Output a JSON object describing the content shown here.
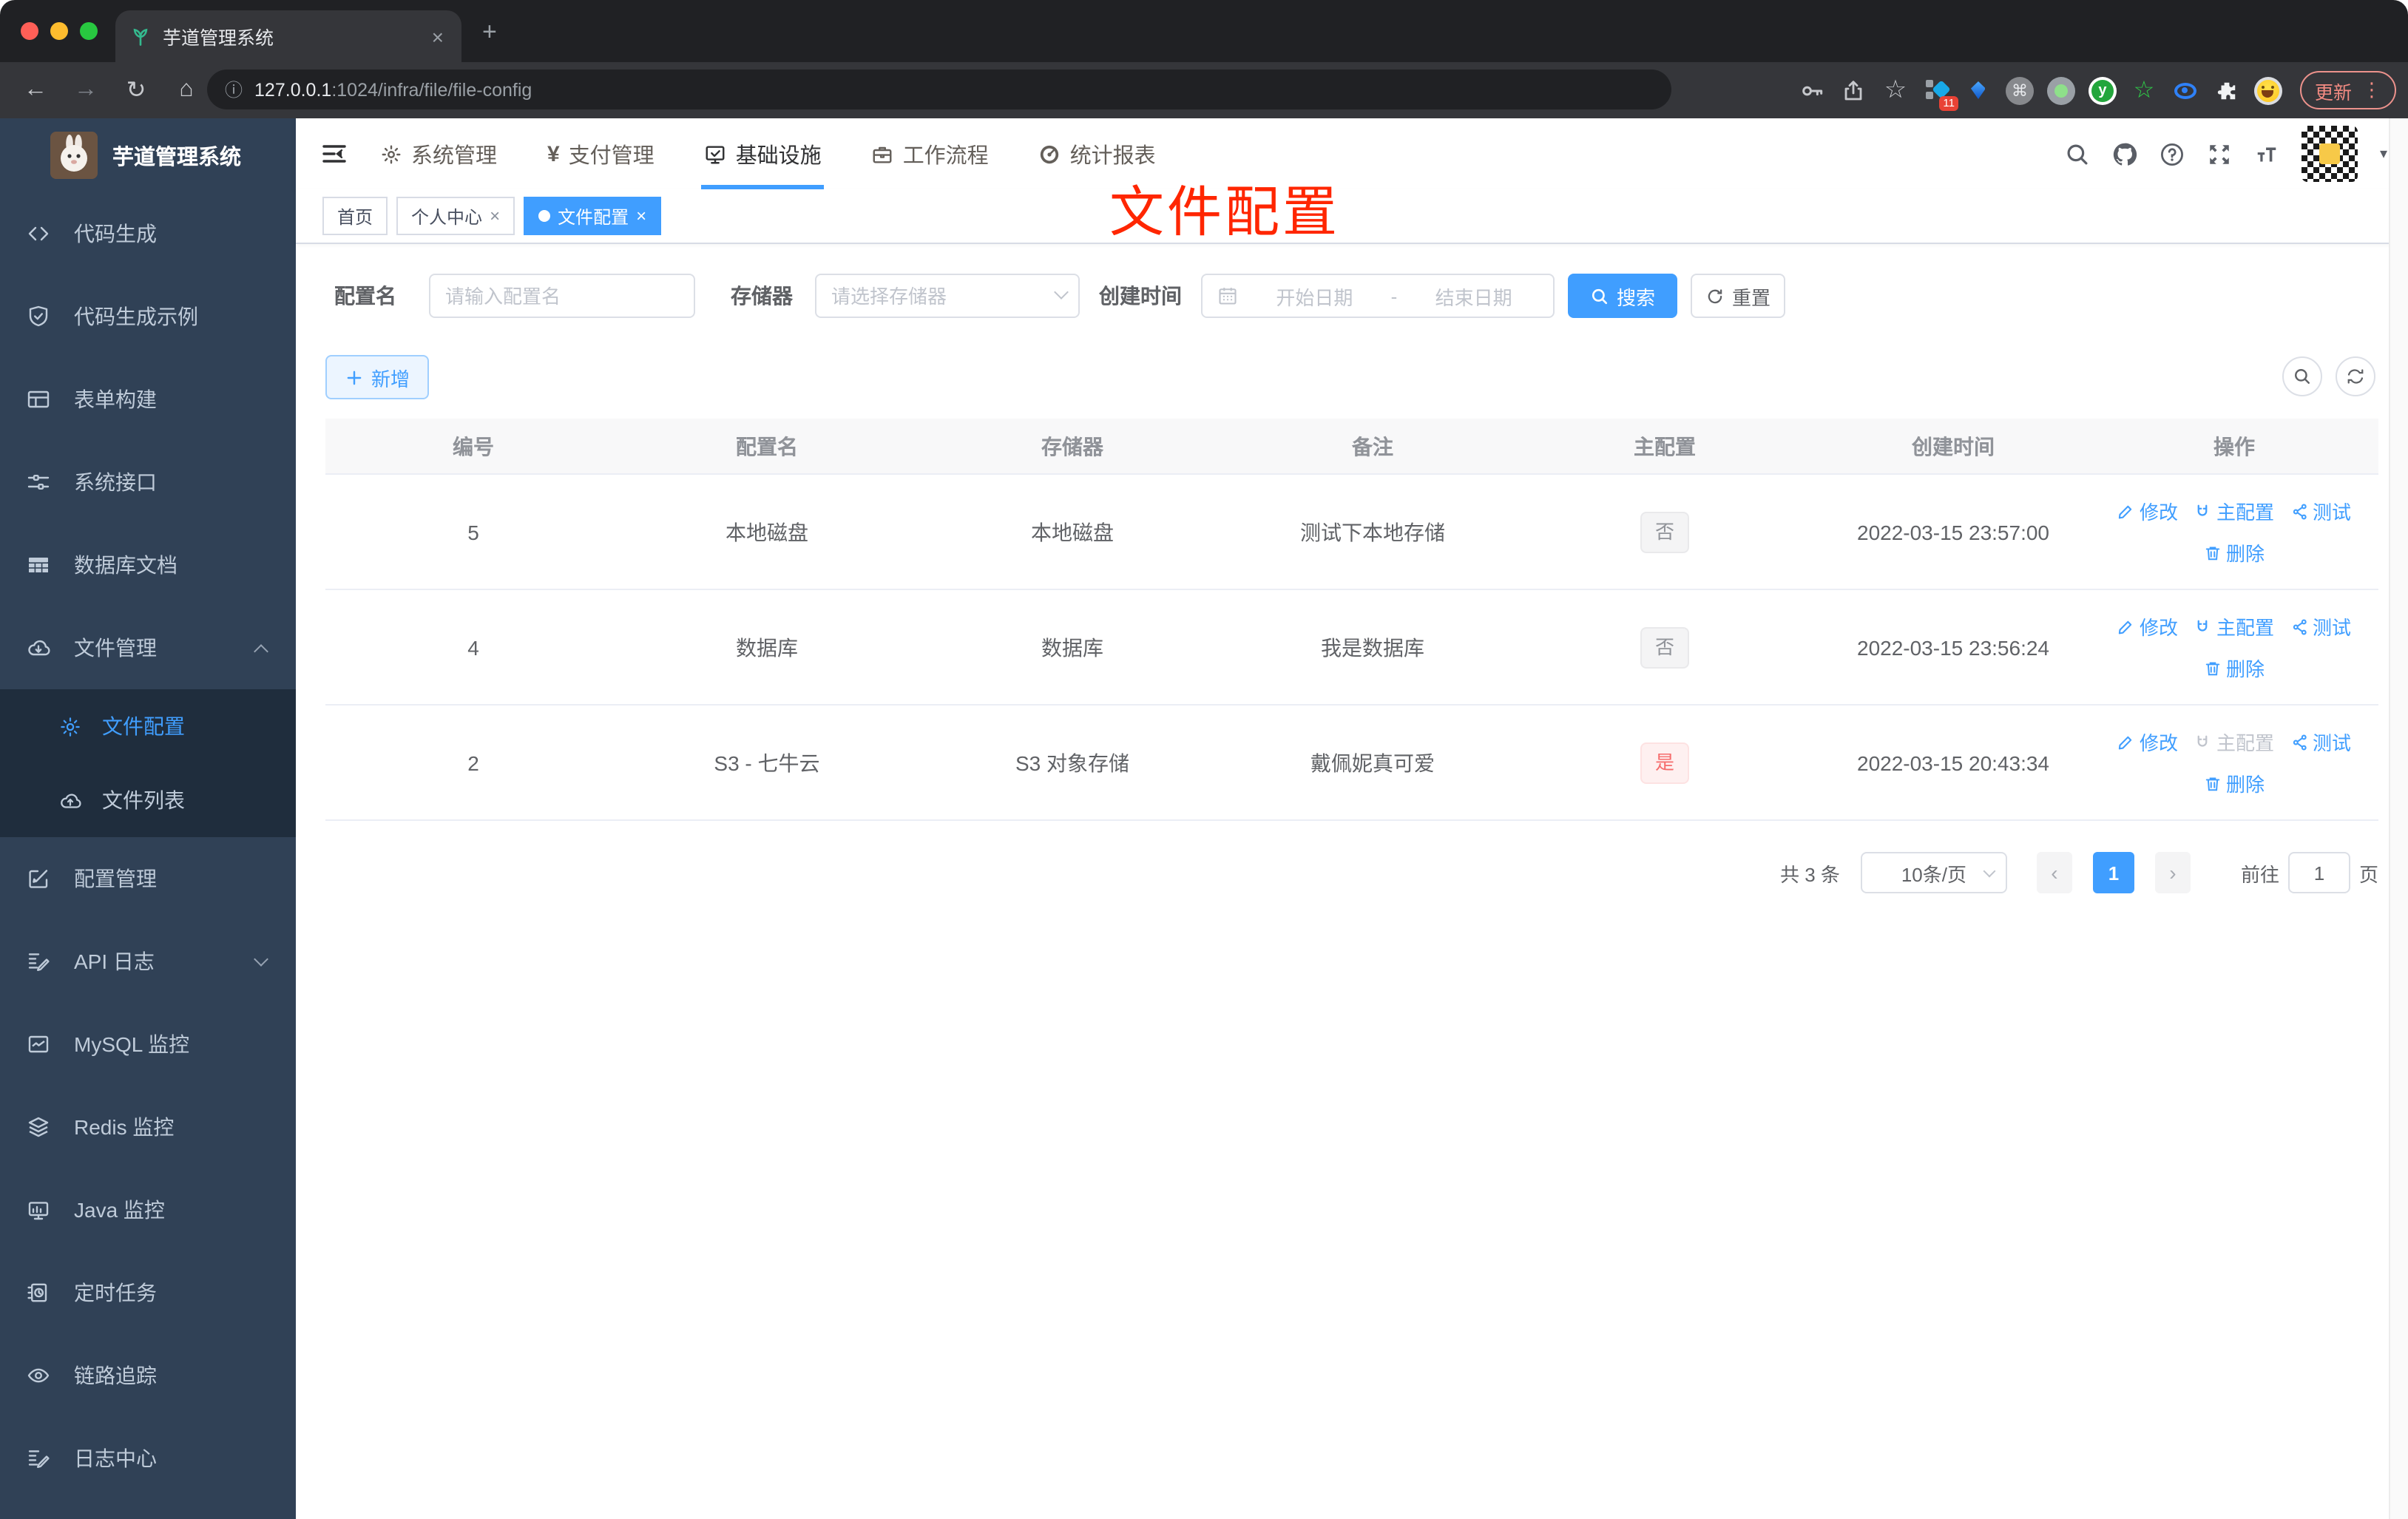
{
  "browser": {
    "tab_title": "芋道管理系统",
    "url_host": "127.0.0.1",
    "url_rest": ":1024/infra/file/file-config",
    "update_label": "更新",
    "extension_badge": "11"
  },
  "glyphs": {
    "close": "×",
    "plus": "+",
    "back": "←",
    "forward": "→",
    "reload": "↻",
    "home": "⌂",
    "info": "ⓘ",
    "star": "☆",
    "cmd": "⌘",
    "v": "y",
    "green_star": "☆",
    "dots": "⋮",
    "caret": "▾",
    "yen": "¥",
    "prev": "‹",
    "next": "›",
    "range_sep": "-",
    "add_plus": "＋"
  },
  "sidebar": {
    "title": "芋道管理系统",
    "items": [
      {
        "label": "代码生成"
      },
      {
        "label": "代码生成示例"
      },
      {
        "label": "表单构建"
      },
      {
        "label": "系统接口"
      },
      {
        "label": "数据库文档"
      },
      {
        "label": "文件管理"
      },
      {
        "label": "文件配置"
      },
      {
        "label": "文件列表"
      },
      {
        "label": "配置管理"
      },
      {
        "label": "API 日志"
      },
      {
        "label": "MySQL 监控"
      },
      {
        "label": "Redis 监控"
      },
      {
        "label": "Java 监控"
      },
      {
        "label": "定时任务"
      },
      {
        "label": "链路追踪"
      },
      {
        "label": "日志中心"
      }
    ]
  },
  "header": {
    "nav": [
      {
        "label": "系统管理"
      },
      {
        "label": "支付管理"
      },
      {
        "label": "基础设施"
      },
      {
        "label": "工作流程"
      },
      {
        "label": "统计报表"
      }
    ]
  },
  "tags": {
    "home": "首页",
    "profile": "个人中心",
    "current": "文件配置"
  },
  "annotation": {
    "text": "文件配置",
    "color": "#ff2600"
  },
  "filters": {
    "name_label": "配置名",
    "name_placeholder": "请输入配置名",
    "storage_label": "存储器",
    "storage_placeholder": "请选择存储器",
    "time_label": "创建时间",
    "start_placeholder": "开始日期",
    "end_placeholder": "结束日期",
    "search_label": "搜索",
    "reset_label": "重置",
    "add_label": "新增"
  },
  "table": {
    "headers": [
      "编号",
      "配置名",
      "存储器",
      "备注",
      "主配置",
      "创建时间",
      "操作"
    ],
    "actions": {
      "edit": "修改",
      "master": "主配置",
      "test": "测试",
      "delete": "删除"
    },
    "rows": [
      {
        "id": "5",
        "name": "本地磁盘",
        "storage": "本地磁盘",
        "remark": "测试下本地存储",
        "master": "否",
        "time": "2022-03-15 23:57:00"
      },
      {
        "id": "4",
        "name": "数据库",
        "storage": "数据库",
        "remark": "我是数据库",
        "master": "否",
        "time": "2022-03-15 23:56:24"
      },
      {
        "id": "2",
        "name": "S3 - 七牛云",
        "storage": "S3 对象存储",
        "remark": "戴佩妮真可爱",
        "master": "是",
        "time": "2022-03-15 20:43:34"
      }
    ]
  },
  "pagination": {
    "total": "共 3 条",
    "page_size": "10条/页",
    "page": "1",
    "goto_label": "前往",
    "goto_value": "1",
    "unit_label": "页"
  },
  "colors": {
    "accent": "#409eff",
    "sidebar_bg": "#304156",
    "annotation_red": "#ff2600"
  }
}
